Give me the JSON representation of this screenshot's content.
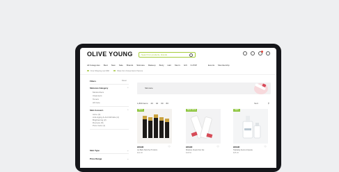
{
  "header": {
    "logo": "OLIVE YOUNG",
    "search_placeholder": "Search for products, brands",
    "icons": [
      "user-icon",
      "heart-icon",
      "cart-icon",
      "globe-icon"
    ]
  },
  "nav": {
    "items": [
      "All Categories",
      "Best",
      "New",
      "Sale",
      "Brands",
      "Skincare",
      "Makeup",
      "Body",
      "Hair",
      "Men's",
      "Gift",
      "K-POP"
    ],
    "right_items": [
      "Events",
      "Membership"
    ]
  },
  "shipping": {
    "left": "Free Shipping over $60",
    "right": "Ships from Korea Fast & Secure"
  },
  "sidebar": {
    "filter_title": "Filters",
    "reset": "Reset",
    "category_title": "Skincare Category",
    "categories": [
      "Moisturizers",
      "Cleansers",
      "Toners",
      "All Care"
    ],
    "concern_title": "Skin Concern",
    "concerns": [
      "Acne (3)",
      "Anti-Aging & Anti-Wrinkle (4)",
      "Brightening (2)",
      "Dryness (5)",
      "Pore Care (1)"
    ],
    "skin_type_title": "Skin Type",
    "price_title": "Price Range"
  },
  "banner": {
    "title": "Skincare"
  },
  "toolbar": {
    "count": "1,800 items",
    "views": [
      "20",
      "40",
      "60",
      "80"
    ],
    "sort": "Sort",
    "filter_icon": "filter-icon"
  },
  "products": [
    {
      "tag": "BEST",
      "brand": "BRAND",
      "name": "Lip Balm Stick Set 5 Colors",
      "price": "$22.00"
    },
    {
      "tag": "BEST PICK",
      "brand": "BRAND",
      "name": "Moisture Cream Duo Set",
      "price": "$18.50"
    },
    {
      "tag": "NEW",
      "brand": "BRAND",
      "name": "Hydrating Serum Ampoule",
      "price": "$25.00"
    }
  ]
}
